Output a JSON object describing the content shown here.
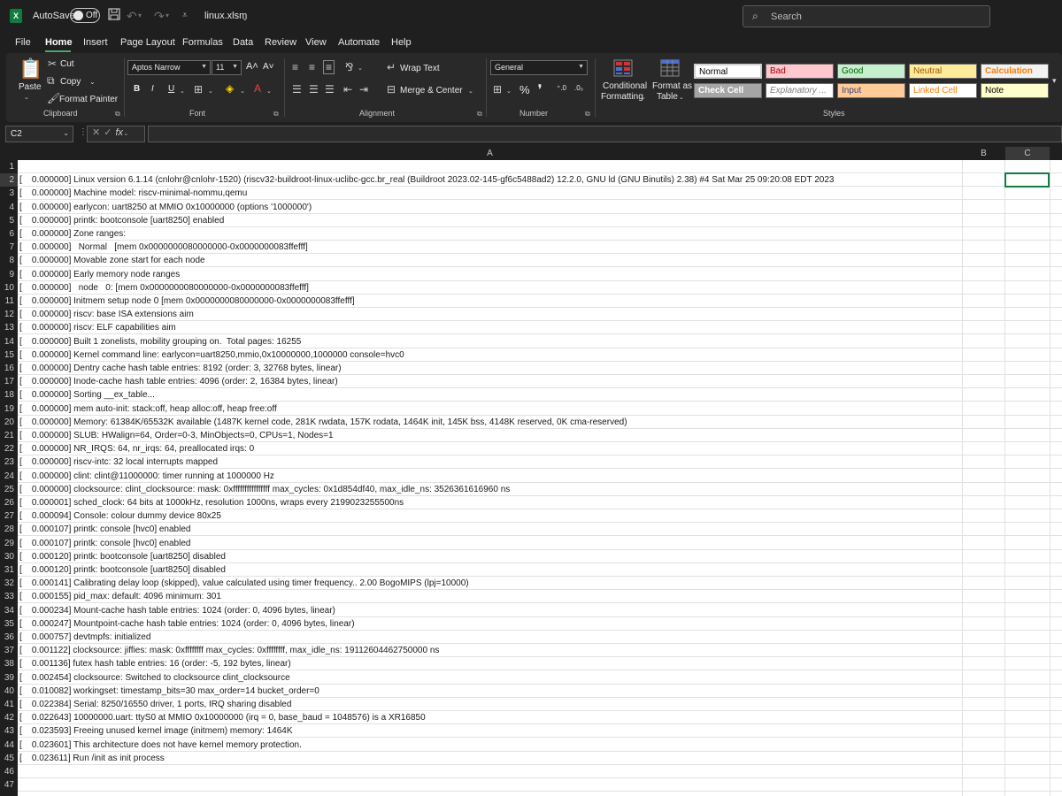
{
  "titlebar": {
    "autosave_label": "AutoSave",
    "toggle_state": "Off",
    "filename": "linux.xlsm",
    "search_placeholder": "Search",
    "icons": [
      "excel-logo",
      "save-icon",
      "undo-icon",
      "redo-icon",
      "customize-icon"
    ]
  },
  "menu": {
    "tabs": [
      "File",
      "Home",
      "Insert",
      "Page Layout",
      "Formulas",
      "Data",
      "Review",
      "View",
      "Automate",
      "Help"
    ],
    "active": "Home"
  },
  "ribbon": {
    "clipboard": {
      "paste": "Paste",
      "cut": "Cut",
      "copy": "Copy",
      "format_painter": "Format Painter",
      "label": "Clipboard"
    },
    "font": {
      "name": "Aptos Narrow",
      "size": "11",
      "label": "Font",
      "bold": "B",
      "italic": "I",
      "underline": "U"
    },
    "alignment": {
      "wrap_text": "Wrap Text",
      "merge_center": "Merge & Center",
      "label": "Alignment"
    },
    "number": {
      "format": "General",
      "label": "Number"
    },
    "styles": {
      "conditional_formatting_1": "Conditional",
      "conditional_formatting_2": "Formatting",
      "format_as_table_1": "Format as",
      "format_as_table_2": "Table",
      "label": "Styles",
      "cells": [
        {
          "name": "Normal",
          "bg": "#ffffff",
          "fg": "#000000"
        },
        {
          "name": "Bad",
          "bg": "#ffc7ce",
          "fg": "#9c0006"
        },
        {
          "name": "Good",
          "bg": "#c6efce",
          "fg": "#006100"
        },
        {
          "name": "Neutral",
          "bg": "#ffeb9c",
          "fg": "#9c5700"
        },
        {
          "name": "Calculation",
          "bg": "#f2f2f2",
          "fg": "#fa7d00"
        },
        {
          "name": "Check Cell",
          "bg": "#a5a5a5",
          "fg": "#ffffff"
        },
        {
          "name": "Explanatory ...",
          "bg": "#ffffff",
          "fg": "#7f7f7f"
        },
        {
          "name": "Input",
          "bg": "#ffcc99",
          "fg": "#3f3f76"
        },
        {
          "name": "Linked Cell",
          "bg": "#ffffff",
          "fg": "#fa7d00"
        },
        {
          "name": "Note",
          "bg": "#ffffcc",
          "fg": "#000000"
        }
      ]
    }
  },
  "formula_bar": {
    "cell_ref": "C2",
    "fx": "fx",
    "content": ""
  },
  "columns": [
    "A",
    "B",
    "C"
  ],
  "rows": [
    {
      "n": "1",
      "text": ""
    },
    {
      "n": "2",
      "text": "[    0.000000] Linux version 6.1.14 (cnlohr@cnlohr-1520) (riscv32-buildroot-linux-uclibc-gcc.br_real (Buildroot 2023.02-145-gf6c5488ad2) 12.2.0, GNU ld (GNU Binutils) 2.38) #4 Sat Mar 25 09:20:08 EDT 2023"
    },
    {
      "n": "3",
      "text": "[    0.000000] Machine model: riscv-minimal-nommu,qemu"
    },
    {
      "n": "4",
      "text": "[    0.000000] earlycon: uart8250 at MMIO 0x10000000 (options '1000000')"
    },
    {
      "n": "5",
      "text": "[    0.000000] printk: bootconsole [uart8250] enabled"
    },
    {
      "n": "6",
      "text": "[    0.000000] Zone ranges:"
    },
    {
      "n": "7",
      "text": "[    0.000000]   Normal   [mem 0x0000000080000000-0x0000000083ffefff]"
    },
    {
      "n": "8",
      "text": "[    0.000000] Movable zone start for each node"
    },
    {
      "n": "9",
      "text": "[    0.000000] Early memory node ranges"
    },
    {
      "n": "10",
      "text": "[    0.000000]   node   0: [mem 0x0000000080000000-0x0000000083ffefff]"
    },
    {
      "n": "11",
      "text": "[    0.000000] Initmem setup node 0 [mem 0x0000000080000000-0x0000000083ffefff]"
    },
    {
      "n": "12",
      "text": "[    0.000000] riscv: base ISA extensions aim"
    },
    {
      "n": "13",
      "text": "[    0.000000] riscv: ELF capabilities aim"
    },
    {
      "n": "14",
      "text": "[    0.000000] Built 1 zonelists, mobility grouping on.  Total pages: 16255"
    },
    {
      "n": "15",
      "text": "[    0.000000] Kernel command line: earlycon=uart8250,mmio,0x10000000,1000000 console=hvc0"
    },
    {
      "n": "16",
      "text": "[    0.000000] Dentry cache hash table entries: 8192 (order: 3, 32768 bytes, linear)"
    },
    {
      "n": "17",
      "text": "[    0.000000] Inode-cache hash table entries: 4096 (order: 2, 16384 bytes, linear)"
    },
    {
      "n": "18",
      "text": "[    0.000000] Sorting __ex_table..."
    },
    {
      "n": "19",
      "text": "[    0.000000] mem auto-init: stack:off, heap alloc:off, heap free:off"
    },
    {
      "n": "20",
      "text": "[    0.000000] Memory: 61384K/65532K available (1487K kernel code, 281K rwdata, 157K rodata, 1464K init, 145K bss, 4148K reserved, 0K cma-reserved)"
    },
    {
      "n": "21",
      "text": "[    0.000000] SLUB: HWalign=64, Order=0-3, MinObjects=0, CPUs=1, Nodes=1"
    },
    {
      "n": "22",
      "text": "[    0.000000] NR_IRQS: 64, nr_irqs: 64, preallocated irqs: 0"
    },
    {
      "n": "23",
      "text": "[    0.000000] riscv-intc: 32 local interrupts mapped"
    },
    {
      "n": "24",
      "text": "[    0.000000] clint: clint@11000000: timer running at 1000000 Hz"
    },
    {
      "n": "25",
      "text": "[    0.000000] clocksource: clint_clocksource: mask: 0xffffffffffffffff max_cycles: 0x1d854df40, max_idle_ns: 3526361616960 ns"
    },
    {
      "n": "26",
      "text": "[    0.000001] sched_clock: 64 bits at 1000kHz, resolution 1000ns, wraps every 2199023255500ns"
    },
    {
      "n": "27",
      "text": "[    0.000094] Console: colour dummy device 80x25"
    },
    {
      "n": "28",
      "text": "[    0.000107] printk: console [hvc0] enabled"
    },
    {
      "n": "29",
      "text": "[    0.000107] printk: console [hvc0] enabled"
    },
    {
      "n": "30",
      "text": "[    0.000120] printk: bootconsole [uart8250] disabled"
    },
    {
      "n": "31",
      "text": "[    0.000120] printk: bootconsole [uart8250] disabled"
    },
    {
      "n": "32",
      "text": "[    0.000141] Calibrating delay loop (skipped), value calculated using timer frequency.. 2.00 BogoMIPS (lpj=10000)"
    },
    {
      "n": "33",
      "text": "[    0.000155] pid_max: default: 4096 minimum: 301"
    },
    {
      "n": "34",
      "text": "[    0.000234] Mount-cache hash table entries: 1024 (order: 0, 4096 bytes, linear)"
    },
    {
      "n": "35",
      "text": "[    0.000247] Mountpoint-cache hash table entries: 1024 (order: 0, 4096 bytes, linear)"
    },
    {
      "n": "36",
      "text": "[    0.000757] devtmpfs: initialized"
    },
    {
      "n": "37",
      "text": "[    0.001122] clocksource: jiffies: mask: 0xffffffff max_cycles: 0xffffffff, max_idle_ns: 19112604462750000 ns"
    },
    {
      "n": "38",
      "text": "[    0.001136] futex hash table entries: 16 (order: -5, 192 bytes, linear)"
    },
    {
      "n": "39",
      "text": "[    0.002454] clocksource: Switched to clocksource clint_clocksource"
    },
    {
      "n": "40",
      "text": "[    0.010082] workingset: timestamp_bits=30 max_order=14 bucket_order=0"
    },
    {
      "n": "41",
      "text": "[    0.022384] Serial: 8250/16550 driver, 1 ports, IRQ sharing disabled"
    },
    {
      "n": "42",
      "text": "[    0.022643] 10000000.uart: ttyS0 at MMIO 0x10000000 (irq = 0, base_baud = 1048576) is a XR16850"
    },
    {
      "n": "43",
      "text": "[    0.023593] Freeing unused kernel image (initmem) memory: 1464K"
    },
    {
      "n": "44",
      "text": "[    0.023601] This architecture does not have kernel memory protection."
    },
    {
      "n": "45",
      "text": "[    0.023611] Run /init as init process"
    },
    {
      "n": "46",
      "text": ""
    },
    {
      "n": "47",
      "text": ""
    }
  ]
}
